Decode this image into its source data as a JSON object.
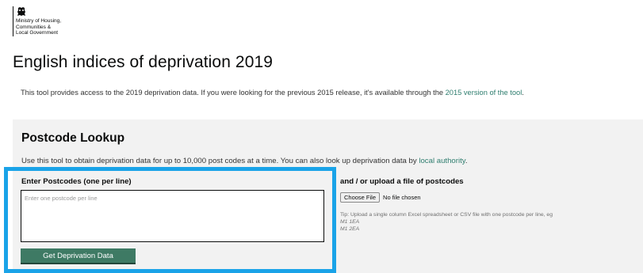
{
  "logo": {
    "lines": [
      "Ministry of Housing,",
      "Communities &",
      "Local Government"
    ]
  },
  "page": {
    "title": "English indices of deprivation 2019",
    "intro_text": "This tool provides access to the 2019 deprivation data. If you were looking for the previous 2015 release, it's available through the ",
    "intro_link": "2015 version of the tool",
    "intro_end": "."
  },
  "lookup": {
    "title": "Postcode Lookup",
    "description_text": "Use this tool to obtain deprivation data for up to 10,000 post codes at a time. You can also look up deprivation data by ",
    "description_link": "local authority",
    "description_end": ".",
    "enter_label": "Enter Postcodes (one per line)",
    "input_placeholder": "Enter one postcode per line",
    "input_value": "",
    "submit_label": "Get Deprivation Data",
    "upload_label": "and / or upload a file of postcodes",
    "choose_file_label": "Choose File",
    "no_file_text": "No file chosen",
    "tip_text": "Tip: Upload a single column Excel spreadsheet or CSV file with one postcode per line, eg",
    "examples": [
      "M1 1EA",
      "M1 2EA"
    ]
  },
  "colors": {
    "accent_highlight": "#1aa3e8",
    "button": "#3e7a64",
    "link": "#2e7d6e",
    "panel_bg": "#f2f2f2"
  }
}
